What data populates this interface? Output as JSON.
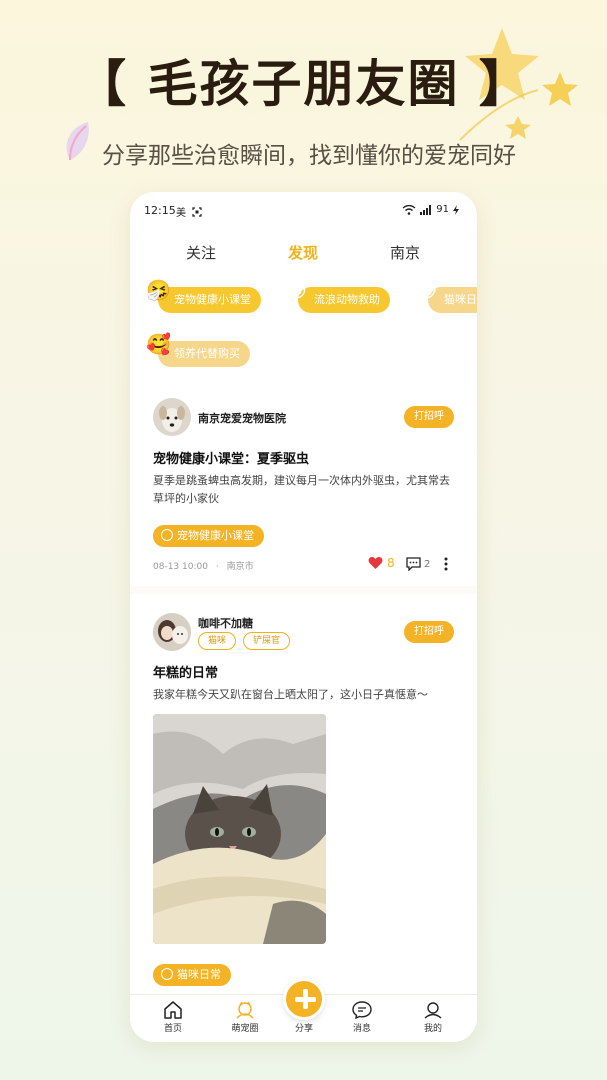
{
  "promo": {
    "title": "【 毛孩子朋友圈 】",
    "subtitle": "分享那些治愈瞬间，找到懂你的爱宠同好"
  },
  "status_bar": {
    "time": "12:15",
    "left_icons": "美",
    "battery": "91"
  },
  "tabs": [
    {
      "label": "关注",
      "active": false
    },
    {
      "label": "发现",
      "active": true
    },
    {
      "label": "南京",
      "active": false
    }
  ],
  "topics": [
    {
      "label": "宠物健康小课堂",
      "emoji": "🤧"
    },
    {
      "label": "流浪动物救助",
      "emoji": "😍"
    },
    {
      "label": "猫咪日常",
      "emoji": "😸"
    },
    {
      "label": "领养代替购买",
      "emoji": "🥰"
    }
  ],
  "posts": [
    {
      "author": "南京宠爱宠物医院",
      "greet": "打招呼",
      "title": "宠物健康小课堂：夏季驱虫",
      "body": "夏季是跳蚤蜱虫高发期，建议每月一次体内外驱虫，尤其常去草坪的小家伙",
      "tag": "宠物健康小课堂",
      "date": "08-13 10:00",
      "location": "南京市",
      "likes": "8",
      "comments": "2"
    },
    {
      "author": "咖啡不加糖",
      "chips": [
        "猫咪",
        "铲屎官"
      ],
      "greet": "打招呼",
      "title": "年糕的日常",
      "body": "我家年糕今天又趴在窗台上晒太阳了，这小日子真惬意～",
      "tag": "猫咪日常"
    }
  ],
  "bottom_nav": [
    {
      "label": "首页",
      "icon": "home-icon"
    },
    {
      "label": "萌宠圈",
      "icon": "pet-circle-icon"
    },
    {
      "label": "分享",
      "icon": "plus-icon"
    },
    {
      "label": "消息",
      "icon": "message-icon"
    },
    {
      "label": "我的",
      "icon": "profile-icon"
    }
  ],
  "colors": {
    "accent": "#f4b324",
    "accent_text": "#f0b21c",
    "like_heart": "#e5383b"
  }
}
